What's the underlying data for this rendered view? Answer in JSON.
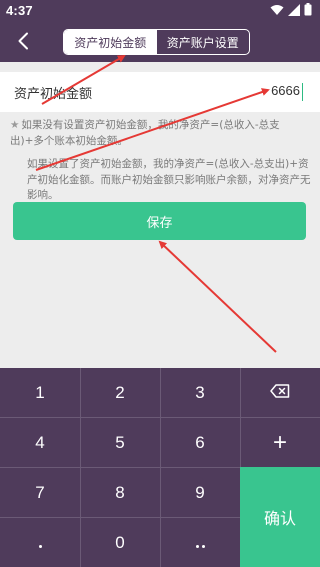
{
  "status_bar": {
    "time": "4:37"
  },
  "header": {
    "tabs": [
      {
        "label": "资产初始金额",
        "active": true
      },
      {
        "label": "资产账户设置",
        "active": false
      }
    ]
  },
  "form": {
    "field_label": "资产初始金额",
    "field_value": "6666",
    "note1": "如果没有设置资产初始金额，我的净资产=(总收入-总支出)+多个账本初始金额。",
    "note2": "如果设置了资产初始金额，我的净资产=(总收入-总支出)+资产初始化金额。而账户初始金额只影响账户余额，对净资产无影响。",
    "save_label": "保存"
  },
  "keypad": {
    "keys": [
      "1",
      "2",
      "3",
      "4",
      "5",
      "6",
      "7",
      "8",
      "9",
      "0"
    ],
    "plus": "+",
    "confirm_label": "确认"
  },
  "colors": {
    "header_bg": "#4f3b5b",
    "accent_green": "#39c58f",
    "annotation_red": "#e53935"
  }
}
